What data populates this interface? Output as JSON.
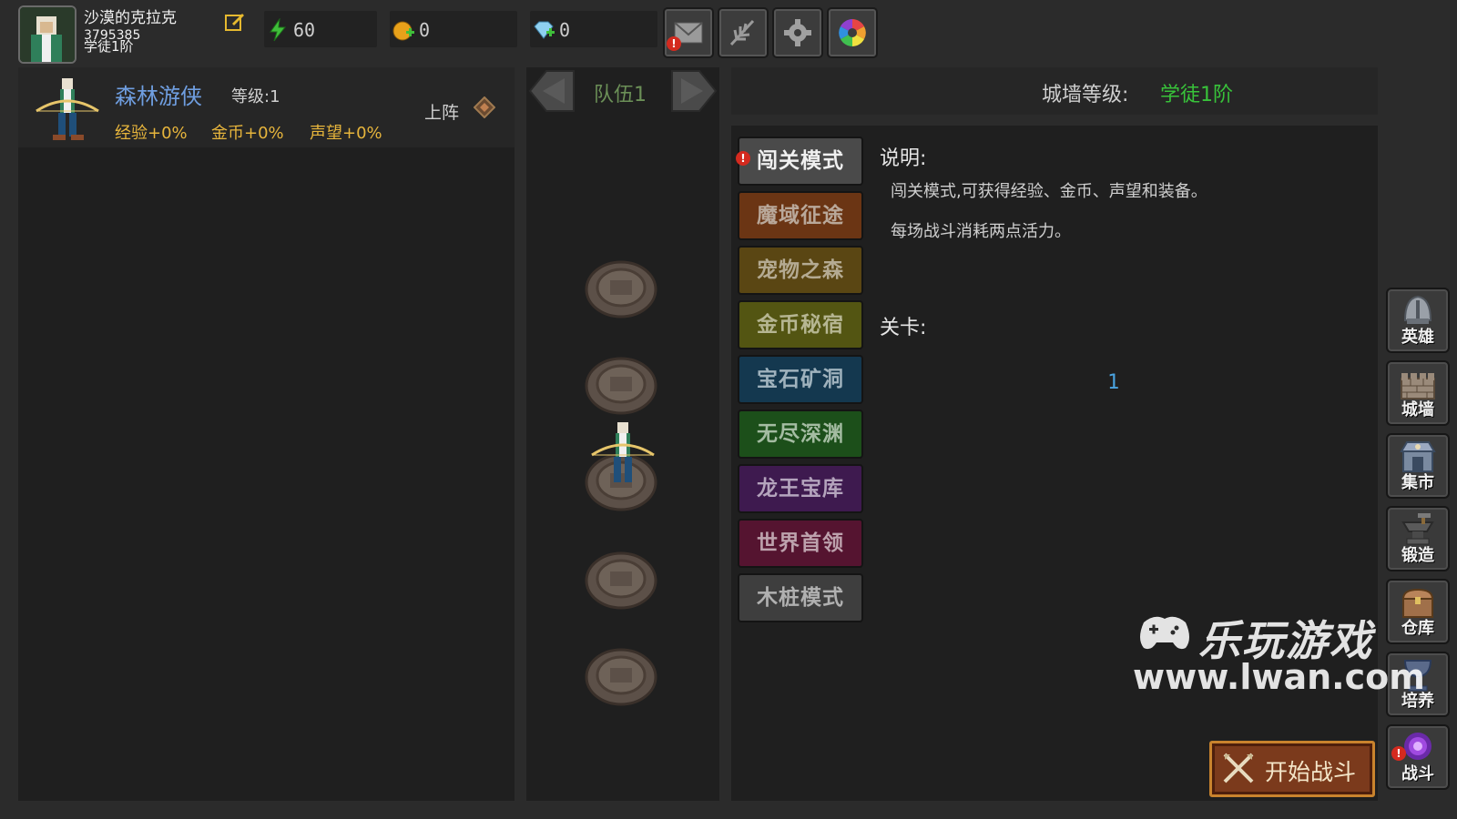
{
  "player": {
    "name": "沙漠的克拉克",
    "id": "3795385",
    "rank": "学徒1阶"
  },
  "resources": {
    "energy": "60",
    "gold": "0",
    "gem": "0"
  },
  "hero": {
    "name": "森林游侠",
    "level": "等级:1",
    "bonus_exp": "经验+0%",
    "bonus_gold": "金币+0%",
    "bonus_fame": "声望+0%",
    "deploy_label": "上阵"
  },
  "team": {
    "label": "队伍1"
  },
  "wall": {
    "label": "城墙等级:",
    "value": "学徒1阶"
  },
  "modes": [
    {
      "label": "闯关模式",
      "color": "#4a4a4a",
      "text_color": "#f0f0f0"
    },
    {
      "label": "魔域征途",
      "color": "#6b3514",
      "text_color": "#b9a89a"
    },
    {
      "label": "宠物之森",
      "color": "#5a4613",
      "text_color": "#b4aa92"
    },
    {
      "label": "金币秘宿",
      "color": "#535512",
      "text_color": "#b6b692"
    },
    {
      "label": "宝石矿洞",
      "color": "#14384f",
      "text_color": "#9fb2bd"
    },
    {
      "label": "无尽深渊",
      "color": "#1c4f1a",
      "text_color": "#a4bca2"
    },
    {
      "label": "龙王宝库",
      "color": "#3e1a4f",
      "text_color": "#b4a4bd"
    },
    {
      "label": "世界首领",
      "color": "#551430",
      "text_color": "#bda2ad"
    },
    {
      "label": "木桩模式",
      "color": "#3e3e3e",
      "text_color": "#b0b0b0"
    }
  ],
  "description": {
    "title": "说明:",
    "lines": [
      "闯关模式,可获得经验、金币、声望和装备。",
      "每场战斗消耗两点活力。"
    ]
  },
  "stage": {
    "title": "关卡:",
    "current": "1"
  },
  "side_nav": [
    {
      "label": "英雄",
      "icon": "helmet-icon"
    },
    {
      "label": "城墙",
      "icon": "wall-icon"
    },
    {
      "label": "集市",
      "icon": "market-icon"
    },
    {
      "label": "锻造",
      "icon": "anvil-icon"
    },
    {
      "label": "仓库",
      "icon": "chest-icon"
    },
    {
      "label": "培养",
      "icon": "chalice-icon"
    },
    {
      "label": "战斗",
      "icon": "portal-icon"
    }
  ],
  "start_button": {
    "label": "开始战斗"
  },
  "watermark": {
    "brand": "乐玩游戏",
    "url": "www.lwan.com"
  },
  "colors": {
    "accent_green": "#38c23a",
    "hero_blue": "#6f9ee0",
    "bonus_gold": "#e7b53c",
    "alert_red": "#d42a1f"
  }
}
